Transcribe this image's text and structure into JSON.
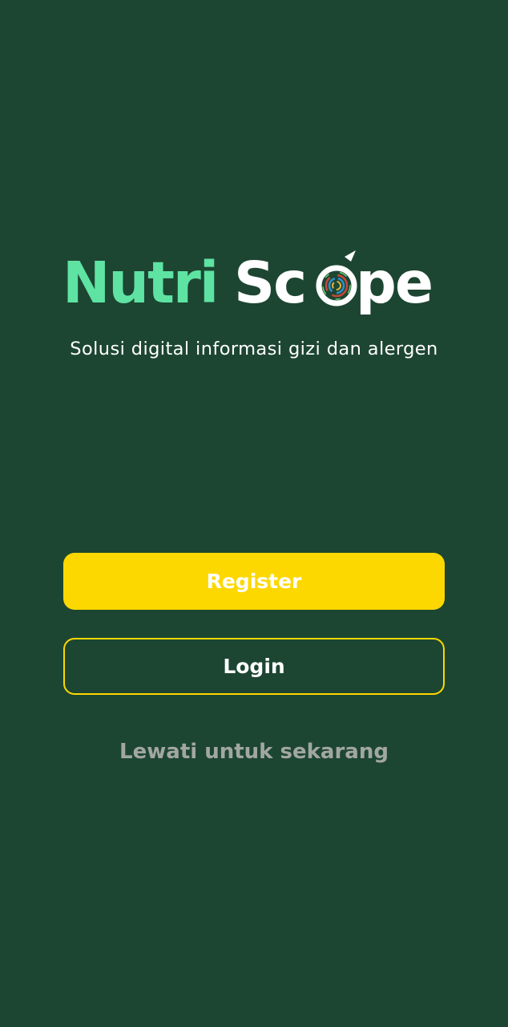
{
  "theme": {
    "background": "#1D4632",
    "accent_yellow": "#FDD800",
    "logo_green": "#5EE3A3",
    "logo_white": "#FFFFFF",
    "text_white": "#FFFFFF",
    "muted_text": "#A2A7A2"
  },
  "logo": {
    "part_green": "Nutri",
    "part_white_1": "Sc",
    "part_white_2": "pe",
    "icon": "scope-lens-icon"
  },
  "tagline": "Solusi digital informasi gizi dan alergen",
  "actions": {
    "register_label": "Register",
    "login_label": "Login",
    "skip_label": "Lewati untuk sekarang"
  }
}
